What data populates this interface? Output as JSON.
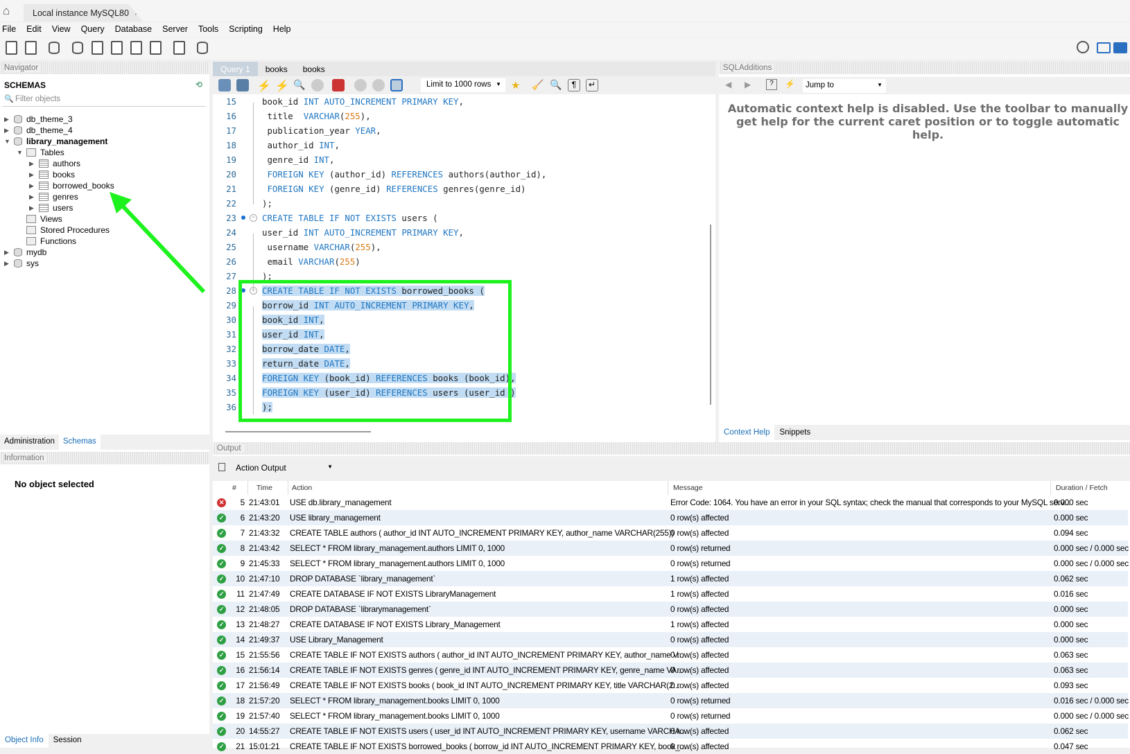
{
  "window": {
    "tab_label": "Local instance MySQL80",
    "close": "×",
    "home_icon": "home-icon"
  },
  "menu": [
    "File",
    "Edit",
    "View",
    "Query",
    "Database",
    "Server",
    "Tools",
    "Scripting",
    "Help"
  ],
  "navigator": {
    "header": "Navigator",
    "schemas_label": "SCHEMAS",
    "filter_placeholder": "Filter objects",
    "tree": [
      {
        "label": "db_theme_3",
        "level": 0,
        "type": "db",
        "expand": "▶"
      },
      {
        "label": "db_theme_4",
        "level": 0,
        "type": "db",
        "expand": "▶"
      },
      {
        "label": "library_management",
        "level": 0,
        "type": "db",
        "expand": "▼",
        "bold": true
      },
      {
        "label": "Tables",
        "level": 1,
        "type": "folder",
        "expand": "▼"
      },
      {
        "label": "authors",
        "level": 2,
        "type": "tbl",
        "expand": "▶"
      },
      {
        "label": "books",
        "level": 2,
        "type": "tbl",
        "expand": "▶"
      },
      {
        "label": "borrowed_books",
        "level": 2,
        "type": "tbl",
        "expand": "▶"
      },
      {
        "label": "genres",
        "level": 2,
        "type": "tbl",
        "expand": "▶"
      },
      {
        "label": "users",
        "level": 2,
        "type": "tbl",
        "expand": "▶"
      },
      {
        "label": "Views",
        "level": 1,
        "type": "folder",
        "expand": ""
      },
      {
        "label": "Stored Procedures",
        "level": 1,
        "type": "folder",
        "expand": ""
      },
      {
        "label": "Functions",
        "level": 1,
        "type": "folder",
        "expand": ""
      },
      {
        "label": "mydb",
        "level": 0,
        "type": "db",
        "expand": "▶"
      },
      {
        "label": "sys",
        "level": 0,
        "type": "db",
        "expand": "▶"
      }
    ],
    "tabs": [
      "Administration",
      "Schemas"
    ],
    "active_tab": "Schemas",
    "information_header": "Information",
    "info_text": "No object selected",
    "bottom_tabs": [
      "Object Info",
      "Session"
    ]
  },
  "editor": {
    "tabs": [
      "Query 1",
      "books",
      "books"
    ],
    "limit": "Limit to 1000 rows",
    "lines": [
      {
        "n": "15",
        "seg": [
          [
            "pl",
            "book_id "
          ],
          [
            "kw",
            "INT AUTO_INCREMENT PRIMARY KEY"
          ],
          [
            "pl",
            ","
          ]
        ]
      },
      {
        "n": "16",
        "seg": [
          [
            "pl",
            " title  "
          ],
          [
            "kw",
            "VARCHAR"
          ],
          [
            "pl",
            "("
          ],
          [
            "num",
            "255"
          ],
          [
            "pl",
            "),"
          ]
        ]
      },
      {
        "n": "17",
        "seg": [
          [
            "pl",
            " publication_year "
          ],
          [
            "kw",
            "YEAR"
          ],
          [
            "pl",
            ","
          ]
        ]
      },
      {
        "n": "18",
        "seg": [
          [
            "pl",
            " author_id "
          ],
          [
            "kw",
            "INT"
          ],
          [
            "pl",
            ","
          ]
        ]
      },
      {
        "n": "19",
        "seg": [
          [
            "pl",
            " genre_id "
          ],
          [
            "kw",
            "INT"
          ],
          [
            "pl",
            ","
          ]
        ]
      },
      {
        "n": "20",
        "seg": [
          [
            "pl",
            " "
          ],
          [
            "kw",
            "FOREIGN KEY"
          ],
          [
            "pl",
            " (author_id) "
          ],
          [
            "kw",
            "REFERENCES"
          ],
          [
            "pl",
            " authors(author_id),"
          ]
        ]
      },
      {
        "n": "21",
        "seg": [
          [
            "pl",
            " "
          ],
          [
            "kw",
            "FOREIGN KEY"
          ],
          [
            "pl",
            " (genre_id) "
          ],
          [
            "kw",
            "REFERENCES"
          ],
          [
            "pl",
            " genres(genre_id)"
          ]
        ]
      },
      {
        "n": "22",
        "seg": [
          [
            "pl",
            ");"
          ]
        ]
      },
      {
        "n": "23",
        "marker": true,
        "seg": [
          [
            "kw",
            "CREATE TABLE IF NOT EXISTS"
          ],
          [
            "pl",
            " users ("
          ]
        ]
      },
      {
        "n": "24",
        "seg": [
          [
            "pl",
            "user_id "
          ],
          [
            "kw",
            "INT AUTO_INCREMENT PRIMARY KEY"
          ],
          [
            "pl",
            ","
          ]
        ]
      },
      {
        "n": "25",
        "seg": [
          [
            "pl",
            " username "
          ],
          [
            "kw",
            "VARCHAR"
          ],
          [
            "pl",
            "("
          ],
          [
            "num",
            "255"
          ],
          [
            "pl",
            "),"
          ]
        ]
      },
      {
        "n": "26",
        "seg": [
          [
            "pl",
            " email "
          ],
          [
            "kw",
            "VARCHAR"
          ],
          [
            "pl",
            "("
          ],
          [
            "num",
            "255"
          ],
          [
            "pl",
            ")"
          ]
        ]
      },
      {
        "n": "27",
        "seg": [
          [
            "pl",
            ");"
          ]
        ]
      },
      {
        "n": "28",
        "marker": true,
        "selected": true,
        "seg": [
          [
            "kw",
            "CREATE TABLE IF NOT EXISTS"
          ],
          [
            "pl",
            " borrowed_books ("
          ]
        ]
      },
      {
        "n": "29",
        "selected": true,
        "seg": [
          [
            "pl",
            "borrow_id "
          ],
          [
            "kw",
            "INT AUTO_INCREMENT PRIMARY KEY"
          ],
          [
            "pl",
            ","
          ]
        ]
      },
      {
        "n": "30",
        "selected": true,
        "seg": [
          [
            "pl",
            "book_id "
          ],
          [
            "kw",
            "INT"
          ],
          [
            "pl",
            ","
          ]
        ]
      },
      {
        "n": "31",
        "selected": true,
        "seg": [
          [
            "pl",
            "user_id "
          ],
          [
            "kw",
            "INT"
          ],
          [
            "pl",
            ","
          ]
        ]
      },
      {
        "n": "32",
        "selected": true,
        "seg": [
          [
            "pl",
            "borrow_date "
          ],
          [
            "kw",
            "DATE"
          ],
          [
            "pl",
            ","
          ]
        ]
      },
      {
        "n": "33",
        "selected": true,
        "seg": [
          [
            "pl",
            "return_date "
          ],
          [
            "kw",
            "DATE"
          ],
          [
            "pl",
            ","
          ]
        ]
      },
      {
        "n": "34",
        "selected": true,
        "seg": [
          [
            "kw",
            "FOREIGN KEY"
          ],
          [
            "pl",
            " (book_id) "
          ],
          [
            "kw",
            "REFERENCES"
          ],
          [
            "pl",
            " books (book_id),"
          ]
        ]
      },
      {
        "n": "35",
        "selected": true,
        "seg": [
          [
            "kw",
            "FOREIGN KEY"
          ],
          [
            "pl",
            " (user_id) "
          ],
          [
            "kw",
            "REFERENCES"
          ],
          [
            "pl",
            " users (user_id )"
          ]
        ]
      },
      {
        "n": "36",
        "selected": true,
        "seg": [
          [
            "pl",
            ");"
          ]
        ]
      }
    ]
  },
  "sql_additions": {
    "header": "SQLAdditions",
    "jump_to": "Jump to",
    "help_text": "Automatic context help is disabled. Use the toolbar to manually get help for the current caret position or to toggle automatic help.",
    "tabs": [
      "Context Help",
      "Snippets"
    ],
    "active_tab": "Context Help"
  },
  "output": {
    "header": "Output",
    "selector": "Action Output",
    "columns": [
      "#",
      "Time",
      "Action",
      "Message",
      "Duration / Fetch"
    ],
    "rows": [
      {
        "status": "error",
        "n": "5",
        "time": "21:43:01",
        "action": "USE db.library_management",
        "message": "Error Code: 1064. You have an error in your SQL syntax; check the manual that corresponds to your MySQL serv...",
        "duration": "0.000 sec"
      },
      {
        "status": "ok",
        "n": "6",
        "time": "21:43:20",
        "action": "USE library_management",
        "message": "0 row(s) affected",
        "duration": "0.000 sec"
      },
      {
        "status": "ok",
        "n": "7",
        "time": "21:43:32",
        "action": "CREATE TABLE authors ( author_id INT AUTO_INCREMENT PRIMARY KEY, author_name VARCHAR(255))",
        "message": "0 row(s) affected",
        "duration": "0.094 sec"
      },
      {
        "status": "ok",
        "n": "8",
        "time": "21:43:42",
        "action": "SELECT * FROM library_management.authors LIMIT 0, 1000",
        "message": "0 row(s) returned",
        "duration": "0.000 sec / 0.000 sec"
      },
      {
        "status": "ok",
        "n": "9",
        "time": "21:45:33",
        "action": "SELECT * FROM library_management.authors LIMIT 0, 1000",
        "message": "0 row(s) returned",
        "duration": "0.000 sec / 0.000 sec"
      },
      {
        "status": "ok",
        "n": "10",
        "time": "21:47:10",
        "action": "DROP DATABASE `library_management`",
        "message": "1 row(s) affected",
        "duration": "0.062 sec"
      },
      {
        "status": "ok",
        "n": "11",
        "time": "21:47:49",
        "action": "CREATE DATABASE IF NOT EXISTS LibraryManagement",
        "message": "1 row(s) affected",
        "duration": "0.016 sec"
      },
      {
        "status": "ok",
        "n": "12",
        "time": "21:48:05",
        "action": "DROP DATABASE `librarymanagement`",
        "message": "0 row(s) affected",
        "duration": "0.000 sec"
      },
      {
        "status": "ok",
        "n": "13",
        "time": "21:48:27",
        "action": "CREATE DATABASE IF NOT EXISTS Library_Management",
        "message": "1 row(s) affected",
        "duration": "0.000 sec"
      },
      {
        "status": "ok",
        "n": "14",
        "time": "21:49:37",
        "action": "USE Library_Management",
        "message": "0 row(s) affected",
        "duration": "0.000 sec"
      },
      {
        "status": "ok",
        "n": "15",
        "time": "21:55:56",
        "action": "CREATE TABLE IF NOT EXISTS authors ( author_id INT AUTO_INCREMENT PRIMARY KEY,  author_name V...",
        "message": "0 row(s) affected",
        "duration": "0.063 sec"
      },
      {
        "status": "ok",
        "n": "16",
        "time": "21:56:14",
        "action": "CREATE TABLE IF NOT EXISTS genres ( genre_id INT AUTO_INCREMENT PRIMARY KEY,  genre_name VA...",
        "message": "0 row(s) affected",
        "duration": "0.063 sec"
      },
      {
        "status": "ok",
        "n": "17",
        "time": "21:56:49",
        "action": "CREATE TABLE IF NOT EXISTS books ( book_id INT AUTO_INCREMENT PRIMARY KEY,  title  VARCHAR(2...",
        "message": "0 row(s) affected",
        "duration": "0.093 sec"
      },
      {
        "status": "ok",
        "n": "18",
        "time": "21:57:20",
        "action": "SELECT * FROM library_management.books LIMIT 0, 1000",
        "message": "0 row(s) returned",
        "duration": "0.016 sec / 0.000 sec"
      },
      {
        "status": "ok",
        "n": "19",
        "time": "21:57:40",
        "action": "SELECT * FROM library_management.books LIMIT 0, 1000",
        "message": "0 row(s) returned",
        "duration": "0.000 sec / 0.000 sec"
      },
      {
        "status": "ok",
        "n": "20",
        "time": "14:55:27",
        "action": "CREATE TABLE IF NOT EXISTS users ( user_id INT AUTO_INCREMENT PRIMARY KEY,  username VARCHA...",
        "message": "0 row(s) affected",
        "duration": "0.062 sec"
      },
      {
        "status": "ok",
        "n": "21",
        "time": "15:01:21",
        "action": "CREATE TABLE IF NOT EXISTS borrowed_books ( borrow_id INT AUTO_INCREMENT PRIMARY KEY, book_...",
        "message": "0 row(s) affected",
        "duration": "0.047 sec"
      }
    ]
  },
  "annotation": {
    "highlight_color": "#1ef21e"
  }
}
